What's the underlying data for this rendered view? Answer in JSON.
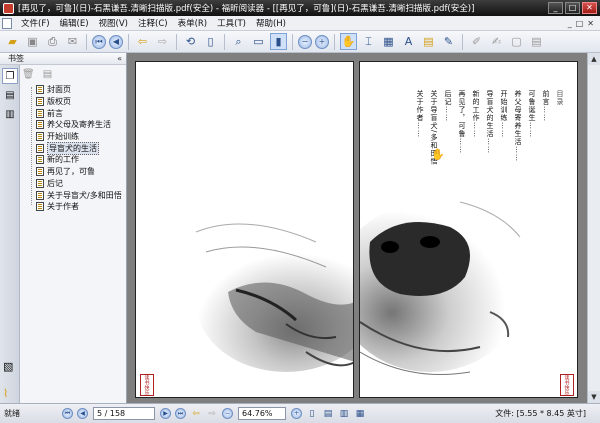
{
  "window": {
    "title": "[再见了，可鲁](日)-石黑谦吾.清晰扫描版.pdf(安全) - 福昕阅读器 - [[再见了，可鲁](日)-石黑谦吾.清晰扫描版.pdf(安全)]",
    "min_label": "_",
    "max_label": "□",
    "close_label": "✕"
  },
  "menu": {
    "items": [
      "文件(F)",
      "编辑(E)",
      "视图(V)",
      "注释(C)",
      "表单(R)",
      "工具(T)",
      "帮助(H)"
    ],
    "right_controls": [
      "_",
      "□",
      "✕"
    ]
  },
  "toolbar": {
    "icons": [
      "open-icon",
      "save-icon",
      "print-icon",
      "email-icon",
      "first-page-icon",
      "prev-page-icon",
      "back-icon",
      "forward-icon",
      "rotate-icon",
      "single-page-icon",
      "zoom-icon",
      "fit-page-icon",
      "fit-width-icon",
      "zoom-out-icon",
      "zoom-in-icon",
      "hand-icon",
      "select-text-icon",
      "snapshot-icon",
      "typewriter-icon",
      "note-icon",
      "highlight-icon",
      "stamp-icon",
      "comment-icon"
    ]
  },
  "bookmarks": {
    "header": "书签",
    "collapse": "«",
    "items": [
      {
        "label": "封面页",
        "selected": false
      },
      {
        "label": "版权页",
        "selected": false
      },
      {
        "label": "前言",
        "selected": false
      },
      {
        "label": "养父母及寄养生活",
        "selected": false
      },
      {
        "label": "开始训练",
        "selected": false
      },
      {
        "label": "导盲犬的生活",
        "selected": true
      },
      {
        "label": "新的工作",
        "selected": false
      },
      {
        "label": "再见了，可鲁",
        "selected": false
      },
      {
        "label": "后记",
        "selected": false
      },
      {
        "label": "关于导盲犬/多和田悟",
        "selected": false
      },
      {
        "label": "关于作者",
        "selected": false
      }
    ]
  },
  "page_right": {
    "toc_lines": [
      "目录",
      "前言……",
      "可鲁诞生……",
      "养父母寄养生活……",
      "开始训练……",
      "导盲犬的生活……",
      "新的工作……",
      "再见了，可鲁……",
      "后记……",
      "关于导盲犬/多和田悟",
      "关于作者……"
    ],
    "seal_text": "读书快乐"
  },
  "page_left": {
    "seal_text": "读书快乐"
  },
  "status": {
    "ready": "就绪",
    "page_value": "5 / 158",
    "zoom_value": "64.76%",
    "file_size": "文件: [5.55 * 8.45 英寸]"
  }
}
